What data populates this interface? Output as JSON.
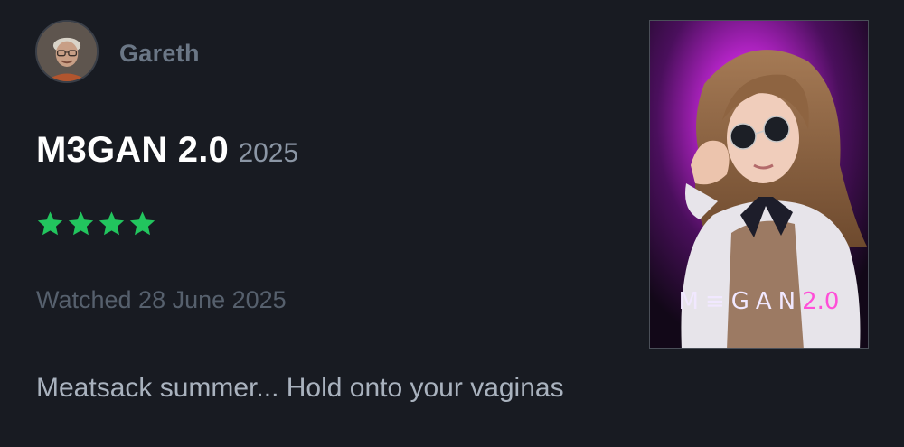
{
  "user": {
    "name": "Gareth"
  },
  "film": {
    "title": "M3GAN 2.0",
    "year": "2025",
    "rating_stars": 4,
    "rating_max": 5
  },
  "watched_text": "Watched 28 June 2025",
  "review_text": "Meatsack summer... Hold onto your vaginas",
  "poster": {
    "title_main": "M≡GAN",
    "title_version": "2.0"
  },
  "colors": {
    "background": "#181b22",
    "star": "#22c55e",
    "poster_glow": "#c026d3",
    "poster_accent": "#ff4fd8"
  }
}
